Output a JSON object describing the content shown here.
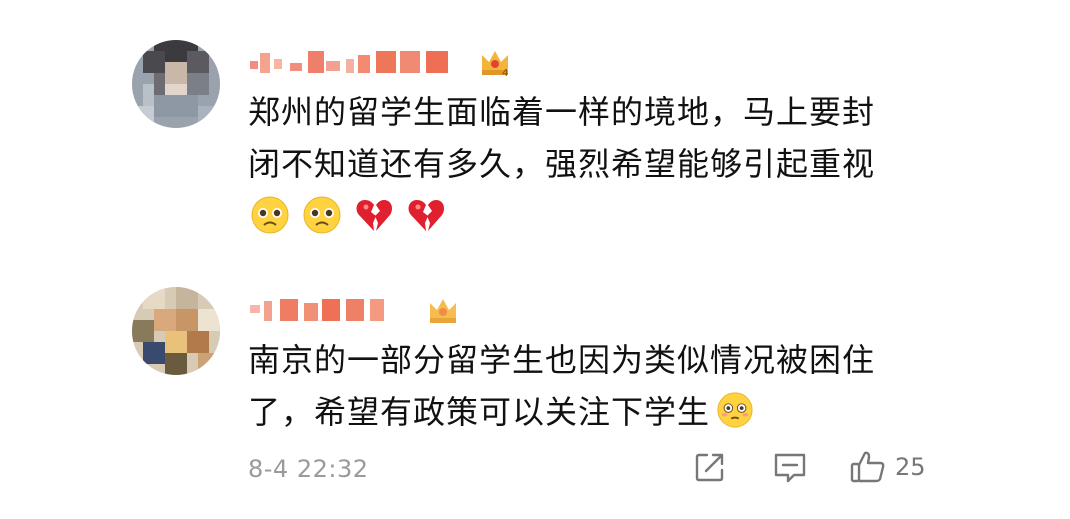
{
  "comments": [
    {
      "username": "(pixelated username)",
      "badge": "crown-badge-level-4",
      "lines": [
        "郑州的留学生面临着一样的境地，马上要封",
        "闭不知道还有多久，强烈希望能够引起重视"
      ],
      "emojis": [
        "pleading-face-icon",
        "pleading-face-icon",
        "broken-heart-icon",
        "broken-heart-icon"
      ]
    },
    {
      "username": "(pixelated username)",
      "badge": "crown-badge",
      "lines": [
        "南京的一部分留学生也因为类似情况被困住",
        "了，希望有政策可以关注下学生"
      ],
      "emojis": [
        "flushed-face-icon"
      ]
    }
  ],
  "footer": {
    "timestamp": "8-4 22:32",
    "actions": [
      "share-icon",
      "comment-icon",
      "like-icon"
    ],
    "like_count": "25"
  },
  "colors": {
    "text": "#111111",
    "meta": "#9a9a9a",
    "icon": "#777777",
    "emoji_face": "#FFD23F",
    "broken_heart": "#E0202E"
  }
}
